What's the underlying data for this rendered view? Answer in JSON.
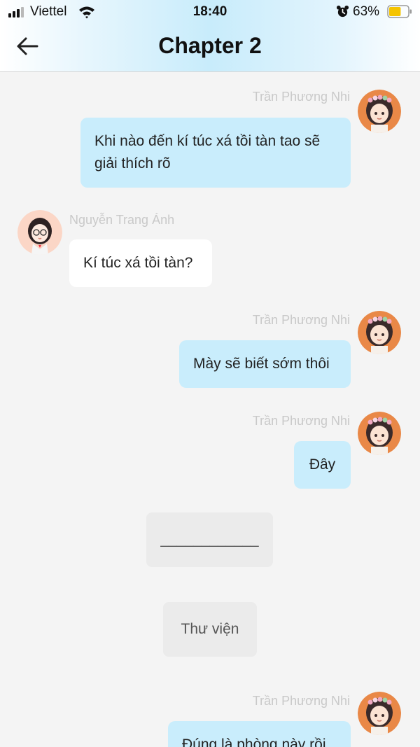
{
  "status_bar": {
    "carrier": "Viettel",
    "time": "18:40",
    "battery_percent": "63%",
    "battery_level": 0.63,
    "signal_bars": 3
  },
  "header": {
    "title": "Chapter 2"
  },
  "messages": [
    {
      "side": "right",
      "sender": "Trần Phương Nhi",
      "text": "Khi nào đến kí túc xá tồi tàn tao sẽ giải thích rõ"
    },
    {
      "side": "left",
      "sender": "Nguyễn Trang Ánh",
      "text": "Kí túc xá tồi tàn?"
    },
    {
      "side": "right",
      "sender": "Trần Phương Nhi",
      "text": "Mày sẽ biết sớm thôi"
    },
    {
      "side": "right",
      "sender": "Trần Phương Nhi",
      "text": "Đây"
    },
    {
      "side": "system",
      "text": "____________"
    },
    {
      "side": "system",
      "text": "Thư viện"
    },
    {
      "side": "right",
      "sender": "Trần Phương Nhi",
      "text": "Đúng là phòng này rồi"
    }
  ],
  "colors": {
    "outgoing_bubble": "#c9edfc",
    "incoming_bubble": "#ffffff",
    "system_box": "#ebebeb",
    "background": "#f4f4f4",
    "battery_fill": "#f5c400"
  }
}
